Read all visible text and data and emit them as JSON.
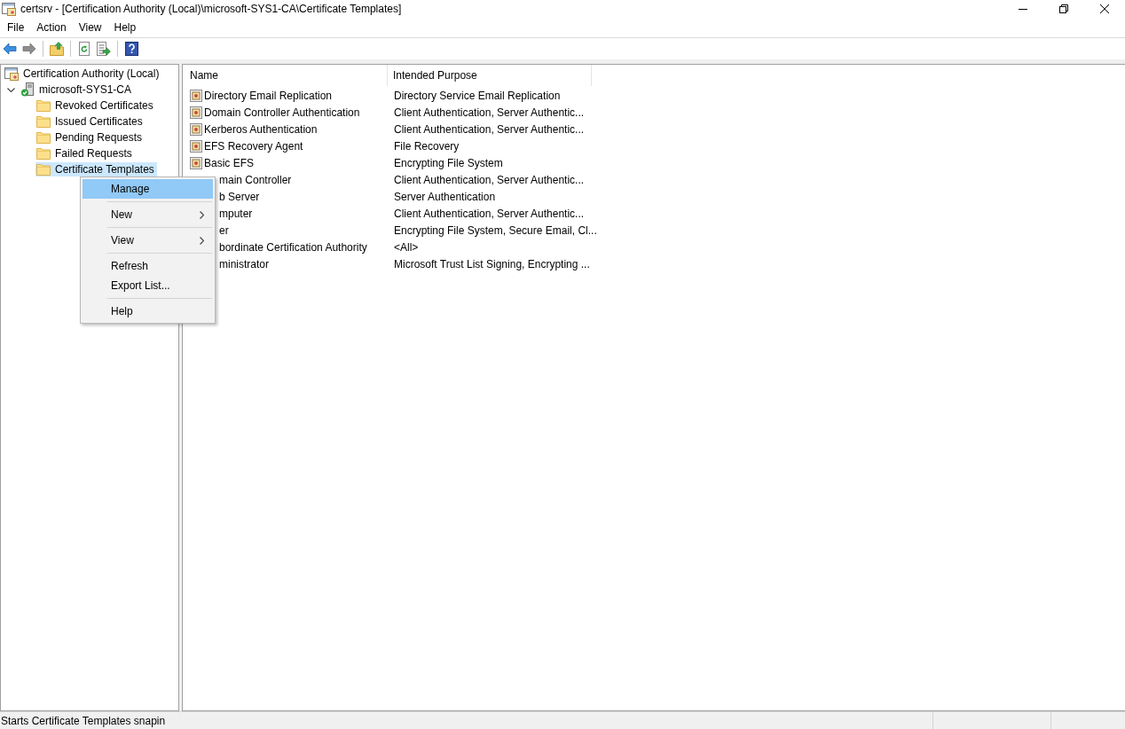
{
  "window": {
    "title": "certsrv - [Certification Authority (Local)\\microsoft-SYS1-CA\\Certificate Templates]"
  },
  "menu_bar": [
    "File",
    "Action",
    "View",
    "Help"
  ],
  "toolbar": {
    "back": {
      "disabled": false
    },
    "forward": {
      "disabled": true
    }
  },
  "tree": [
    {
      "label": "Certification Authority (Local)",
      "kind": "console",
      "selected": false,
      "children": [
        {
          "label": "microsoft-SYS1-CA",
          "kind": "server",
          "expanded": true,
          "selected": false,
          "children": [
            {
              "label": "Revoked Certificates",
              "kind": "folder",
              "selected": false
            },
            {
              "label": "Issued Certificates",
              "kind": "folder",
              "selected": false
            },
            {
              "label": "Pending Requests",
              "kind": "folder",
              "selected": false
            },
            {
              "label": "Failed Requests",
              "kind": "folder",
              "selected": false
            },
            {
              "label": "Certificate Templates",
              "kind": "folder",
              "selected": true
            }
          ]
        }
      ]
    }
  ],
  "list": {
    "columns": [
      "Name",
      "Intended Purpose"
    ],
    "rows": [
      {
        "name": "Directory Email Replication",
        "purpose": "Directory Service Email Replication",
        "covered": false
      },
      {
        "name": "Domain Controller Authentication",
        "purpose": "Client Authentication, Server Authentic...",
        "covered": false
      },
      {
        "name": "Kerberos Authentication",
        "purpose": "Client Authentication, Server Authentic...",
        "covered": false
      },
      {
        "name": "EFS Recovery Agent",
        "purpose": "File Recovery",
        "covered": false
      },
      {
        "name": "Basic EFS",
        "purpose": "Encrypting File System",
        "covered": false
      },
      {
        "name": "main Controller",
        "purpose": "Client Authentication, Server Authentic...",
        "covered": true
      },
      {
        "name": "b Server",
        "purpose": "Server Authentication",
        "covered": true
      },
      {
        "name": "mputer",
        "purpose": "Client Authentication, Server Authentic...",
        "covered": true
      },
      {
        "name": "er",
        "purpose": "Encrypting File System, Secure Email, Cl...",
        "covered": true
      },
      {
        "name": "bordinate Certification Authority",
        "purpose": "<All>",
        "covered": true
      },
      {
        "name": "ministrator",
        "purpose": "Microsoft Trust List Signing, Encrypting ...",
        "covered": true
      }
    ]
  },
  "context_menu": {
    "groups": [
      [
        {
          "label": "Manage",
          "submenu": false,
          "selected": true
        }
      ],
      [
        {
          "label": "New",
          "submenu": true,
          "selected": false
        }
      ],
      [
        {
          "label": "View",
          "submenu": true,
          "selected": false
        }
      ],
      [
        {
          "label": "Refresh",
          "submenu": false,
          "selected": false
        },
        {
          "label": "Export List...",
          "submenu": false,
          "selected": false
        }
      ],
      [
        {
          "label": "Help",
          "submenu": false,
          "selected": false
        }
      ]
    ]
  },
  "status_bar": {
    "text": "Starts Certificate Templates snapin"
  }
}
